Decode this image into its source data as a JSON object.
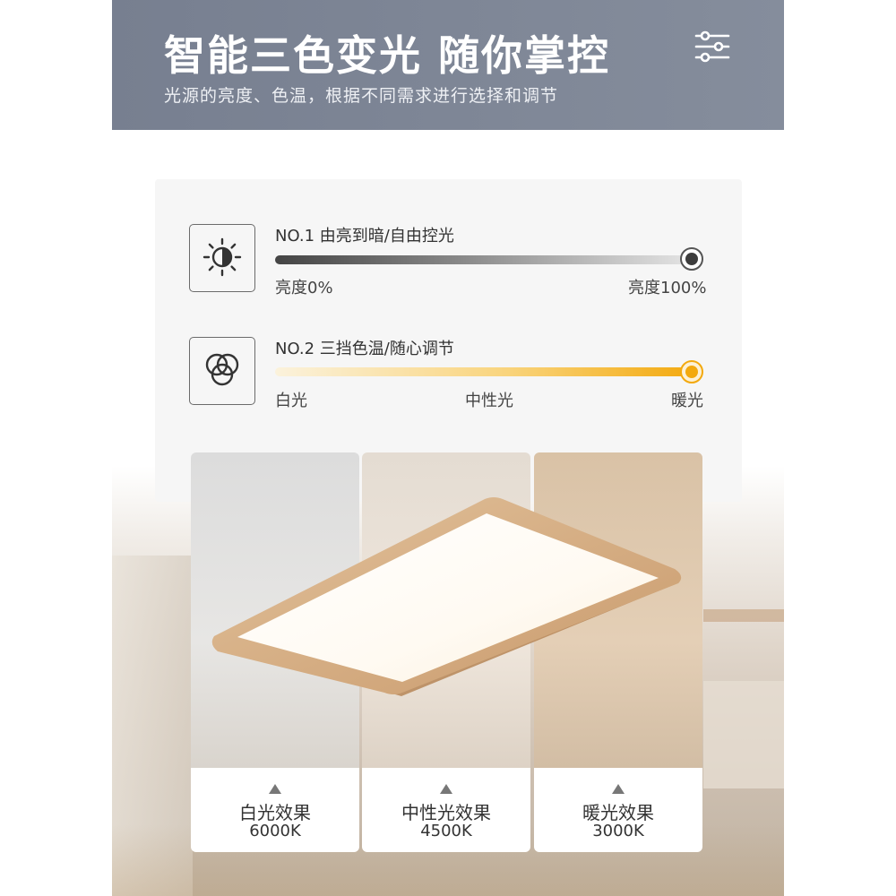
{
  "header": {
    "title": "智能三色变光 随你掌控",
    "subtitle": "光源的亮度、色温，根据不同需求进行选择和调节",
    "icon": "sliders-icon"
  },
  "controls": {
    "brightness": {
      "label": "NO.1 由亮到暗/自由控光",
      "icon": "sun-icon",
      "min_label": "亮度0%",
      "max_label": "亮度100%",
      "level": 1.0
    },
    "color_temp": {
      "label": "NO.2 三挡色温/随心调节",
      "icon": "rgb-circles-icon",
      "stops": [
        "白光",
        "中性光",
        "暖光"
      ],
      "level": 1.0
    }
  },
  "effects": [
    {
      "name": "白光效果",
      "kelvin": "6000K"
    },
    {
      "name": "中性光效果",
      "kelvin": "4500K"
    },
    {
      "name": "暖光效果",
      "kelvin": "3000K"
    }
  ],
  "colors": {
    "header_bg": "#7d8597",
    "warm_accent": "#f3a90e",
    "wood": "#d6b088"
  }
}
